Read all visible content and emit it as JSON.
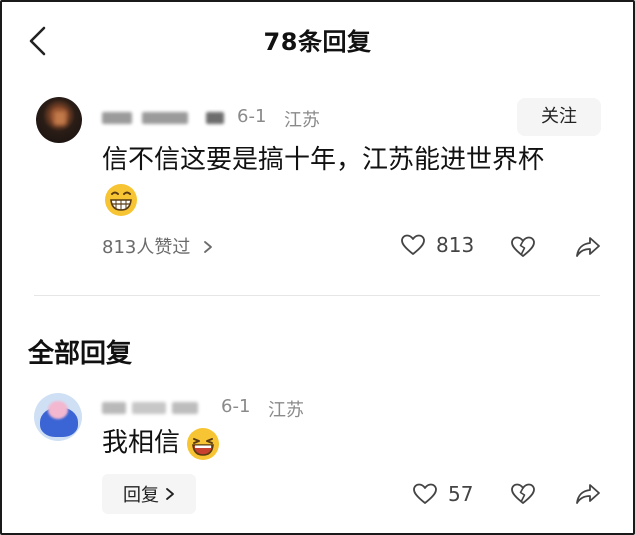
{
  "header": {
    "title": "78条回复"
  },
  "main_comment": {
    "date": "6-1",
    "location": "江苏",
    "follow_label": "关注",
    "text": "信不信这要是搞十年，江苏能进世界杯",
    "likes_summary": "813人赞过",
    "like_count": "813"
  },
  "replies_section": {
    "title": "全部回复"
  },
  "reply": {
    "date": "6-1",
    "location": "江苏",
    "text": "我相信",
    "reply_label": "回复",
    "like_count": "57"
  },
  "icons": [
    "back-arrow-icon",
    "heart-icon",
    "broken-heart-icon",
    "share-icon",
    "grinning-emoji-icon",
    "laughing-emoji-icon",
    "chevron-right-icon"
  ]
}
